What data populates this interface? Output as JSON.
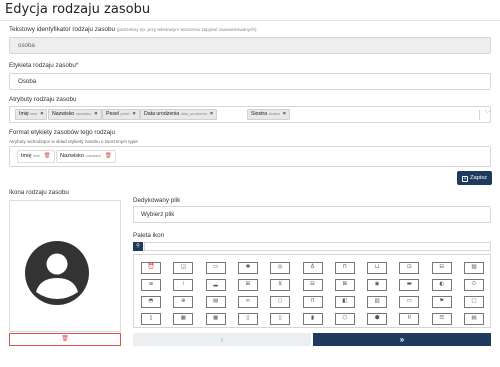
{
  "page": {
    "title": "Edycja rodzaju zasobu"
  },
  "identifier": {
    "label": "Tekstowy identyfikator rodzaju zasobu",
    "hint": "(potrzebny np. przy tekstowym tworzeniu zapytań zaawansowanych)",
    "value": "osoba"
  },
  "display_label": {
    "label": "Etykieta rodzaju zasobu*",
    "value": "Osoba"
  },
  "attributes": {
    "label": "Atrybuty rodzaju zasobu",
    "tags": [
      {
        "label": "Imię",
        "key": "imie"
      },
      {
        "label": "Nazwisko",
        "key": "nazwisko"
      },
      {
        "label": "Pesel",
        "key": "pesel"
      },
      {
        "label": "Data urodzenia",
        "key": "data_urodzenia"
      },
      {
        "label": "Siostra",
        "key": "siostra"
      }
    ],
    "remove_glyph": "×",
    "chevron_glyph": "⌵"
  },
  "format": {
    "label": "Format etykiety zasobów tego rodzaju",
    "hint": "Atrybuty wchodzące w skład etykiety zasobu o tworzonym typie",
    "tags": [
      {
        "label": "Imię",
        "key": "imie"
      },
      {
        "label": "Nazwisko",
        "key": "nazwisko"
      }
    ],
    "delete_glyph": "🗑"
  },
  "save_button": {
    "label": "Zapisz",
    "icon": "save-icon"
  },
  "icon_section": {
    "label": "Ikona rodzaju zasobu",
    "current_icon": "user-circle-icon",
    "delete_glyph": "🗑"
  },
  "dedicated_file": {
    "label": "Dedykowany plik",
    "button_label": "Wybierz plik"
  },
  "palette": {
    "label": "Paleta ikon",
    "search_icon": "search-icon",
    "search_placeholder": "",
    "icons": [
      {
        "name": "alarm-clock-icon",
        "glyph": "⏰"
      },
      {
        "name": "edit-square-icon",
        "glyph": "◲"
      },
      {
        "name": "rectangle-icon",
        "glyph": "▭"
      },
      {
        "name": "asterisk-icon",
        "glyph": "✱"
      },
      {
        "name": "target-icon",
        "glyph": "◎"
      },
      {
        "name": "lightbulb-icon",
        "glyph": "♁"
      },
      {
        "name": "shopping-bag-icon",
        "glyph": "⊓"
      },
      {
        "name": "basket-icon",
        "glyph": "⊔"
      },
      {
        "name": "lock-icon",
        "glyph": "⊡"
      },
      {
        "name": "clipboard-icon",
        "glyph": "⊟"
      },
      {
        "name": "image-icon",
        "glyph": "▨"
      },
      {
        "name": "text-icon",
        "glyph": "≡"
      },
      {
        "name": "signal-icon",
        "glyph": "⁞"
      },
      {
        "name": "chart-bars-icon",
        "glyph": "▂"
      },
      {
        "name": "grid-icon",
        "glyph": "⊞"
      },
      {
        "name": "cart-icon",
        "glyph": "⊻"
      },
      {
        "name": "briefcase-icon",
        "glyph": "⊟"
      },
      {
        "name": "cash-icon",
        "glyph": "⊠"
      },
      {
        "name": "eye-icon",
        "glyph": "◉"
      },
      {
        "name": "battery-icon",
        "glyph": "▬"
      },
      {
        "name": "toggle-icon",
        "glyph": "◐"
      },
      {
        "name": "pill-icon",
        "glyph": "⬭"
      },
      {
        "name": "gamepad-icon",
        "glyph": "◓"
      },
      {
        "name": "printer-icon",
        "glyph": "⊕"
      },
      {
        "name": "building-icon",
        "glyph": "▤"
      },
      {
        "name": "binoculars-icon",
        "glyph": "∞"
      },
      {
        "name": "ring-icon",
        "glyph": "○"
      },
      {
        "name": "storefront-icon",
        "glyph": "⊓"
      },
      {
        "name": "layout-half-icon",
        "glyph": "◧"
      },
      {
        "name": "server-icon",
        "glyph": "▥"
      },
      {
        "name": "card-icon",
        "glyph": "▭"
      },
      {
        "name": "flag-icon",
        "glyph": "⚑"
      },
      {
        "name": "monitor-icon",
        "glyph": "▢"
      },
      {
        "name": "document-icon",
        "glyph": "▯"
      },
      {
        "name": "film-icon",
        "glyph": "▦"
      },
      {
        "name": "calendar-icon",
        "glyph": "▦"
      },
      {
        "name": "book-icon",
        "glyph": "▯"
      },
      {
        "name": "phone-icon",
        "glyph": "▯"
      },
      {
        "name": "sim-card-icon",
        "glyph": "▮"
      },
      {
        "name": "cube-icon",
        "glyph": "⬡"
      },
      {
        "name": "box-icon",
        "glyph": "⬢"
      },
      {
        "name": "bracket-icon",
        "glyph": "⌷"
      },
      {
        "name": "stack-icon",
        "glyph": "☰"
      },
      {
        "name": "table-icon",
        "glyph": "▤"
      }
    ]
  },
  "pagination": {
    "prev_label": "‹",
    "next_label": "»"
  },
  "colors": {
    "primary": "#1e3a5c",
    "danger": "#d9534f",
    "disabled_bg": "#eceef0"
  }
}
